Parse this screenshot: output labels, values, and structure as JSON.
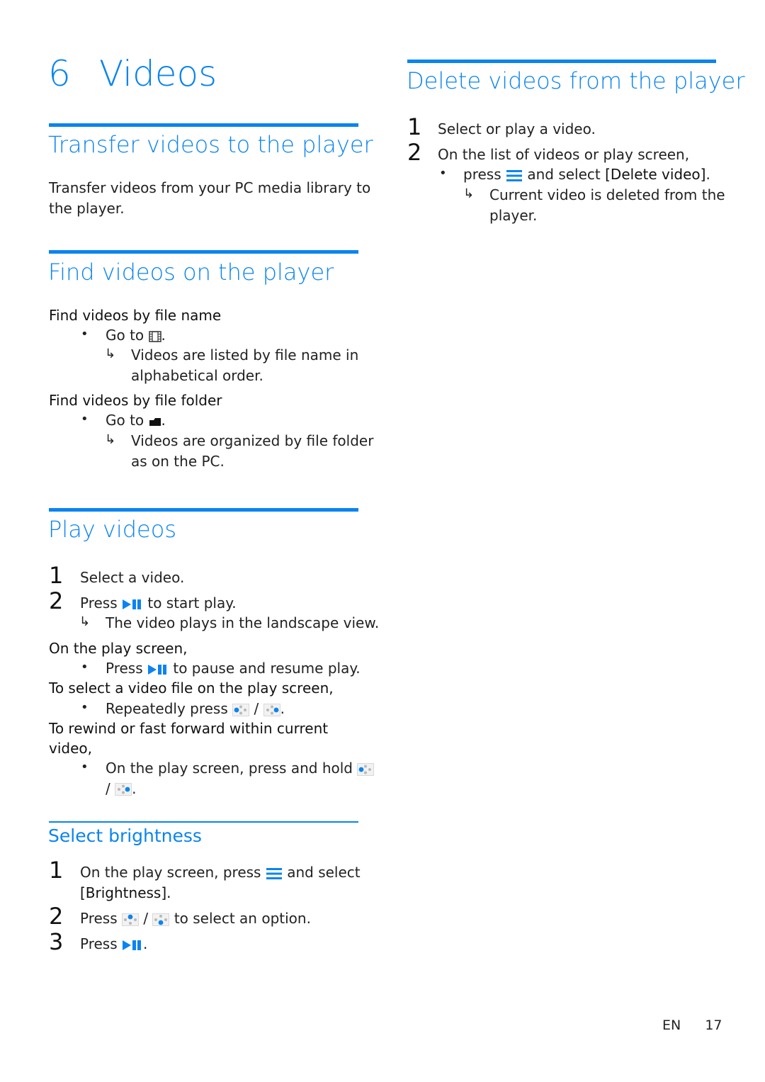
{
  "chapter": {
    "number": "6",
    "title": "Videos"
  },
  "left": {
    "transfer": {
      "heading": "Transfer videos to the player",
      "body_line1": "Transfer videos from your PC media library to",
      "body_line2": "the player."
    },
    "find": {
      "heading": "Find videos on the player",
      "by_name": {
        "label": "Find videos by file name",
        "bullet_prefix": "Go to",
        "bullet_icon": "film-icon",
        "bullet_suffix": ".",
        "result_line1": "Videos are listed by file name in",
        "result_line2": "alphabetical order."
      },
      "by_folder": {
        "label": "Find videos by file folder",
        "bullet_prefix": "Go to",
        "bullet_icon": "folder-icon",
        "bullet_suffix": ".",
        "result_line1": "Videos are organized by file folder",
        "result_line2": "as on the PC."
      }
    },
    "play": {
      "heading": "Play videos",
      "steps": [
        {
          "num": "1",
          "text": "Select a video."
        },
        {
          "num": "2",
          "prefix": "Press",
          "icon": "play-pause-icon",
          "suffix": "to start play.",
          "result": "The video plays in the landscape view."
        }
      ],
      "play_screen": {
        "label": "On the play screen,",
        "bullet_prefix": "Press",
        "bullet_icon": "play-pause-icon",
        "bullet_suffix": "to pause and resume play."
      },
      "select_file": {
        "label": "To select a video file on the play screen,",
        "bullet_prefix": "Repeatedly press",
        "icon_left": "nav-left-icon",
        "separator": "/",
        "icon_right": "nav-right-icon",
        "bullet_suffix": "."
      },
      "rewind": {
        "label_line1": "To rewind or fast forward within current",
        "label_line2": "video,",
        "bullet_prefix": "On the play screen, press and hold",
        "icon_left": "nav-left-icon",
        "separator": "/",
        "icon_right": "nav-right-icon",
        "bullet_suffix": "."
      }
    },
    "brightness": {
      "heading": "Select brightness",
      "step1": {
        "num": "1",
        "prefix": "On the play screen, press",
        "icon": "menu-icon",
        "suffix": "and select",
        "line2": "[Brightness]."
      },
      "step2": {
        "num": "2",
        "prefix": "Press",
        "icon_up": "nav-up-icon",
        "separator": "/",
        "icon_down": "nav-down-icon",
        "suffix": "to select an option."
      },
      "step3": {
        "num": "3",
        "prefix": "Press",
        "icon": "play-pause-icon",
        "suffix": "."
      }
    }
  },
  "right": {
    "delete": {
      "heading": "Delete videos from the player",
      "step1": {
        "num": "1",
        "text": "Select or play a video."
      },
      "step2": {
        "num": "2",
        "text": "On the list of videos or play screen,"
      },
      "bullet_prefix": "press",
      "bullet_icon": "menu-icon",
      "bullet_middle": "and select",
      "bullet_option": "[Delete video]",
      "bullet_suffix": ".",
      "result_line1": "Current video is deleted from the",
      "result_line2": "player."
    }
  },
  "footer": {
    "lang": "EN",
    "page": "17"
  },
  "symbols": {
    "bullet": "•",
    "result_arrow": "↳"
  },
  "colors": {
    "accent": "#0a84f0",
    "icon_grey": "#b8b8b8"
  }
}
